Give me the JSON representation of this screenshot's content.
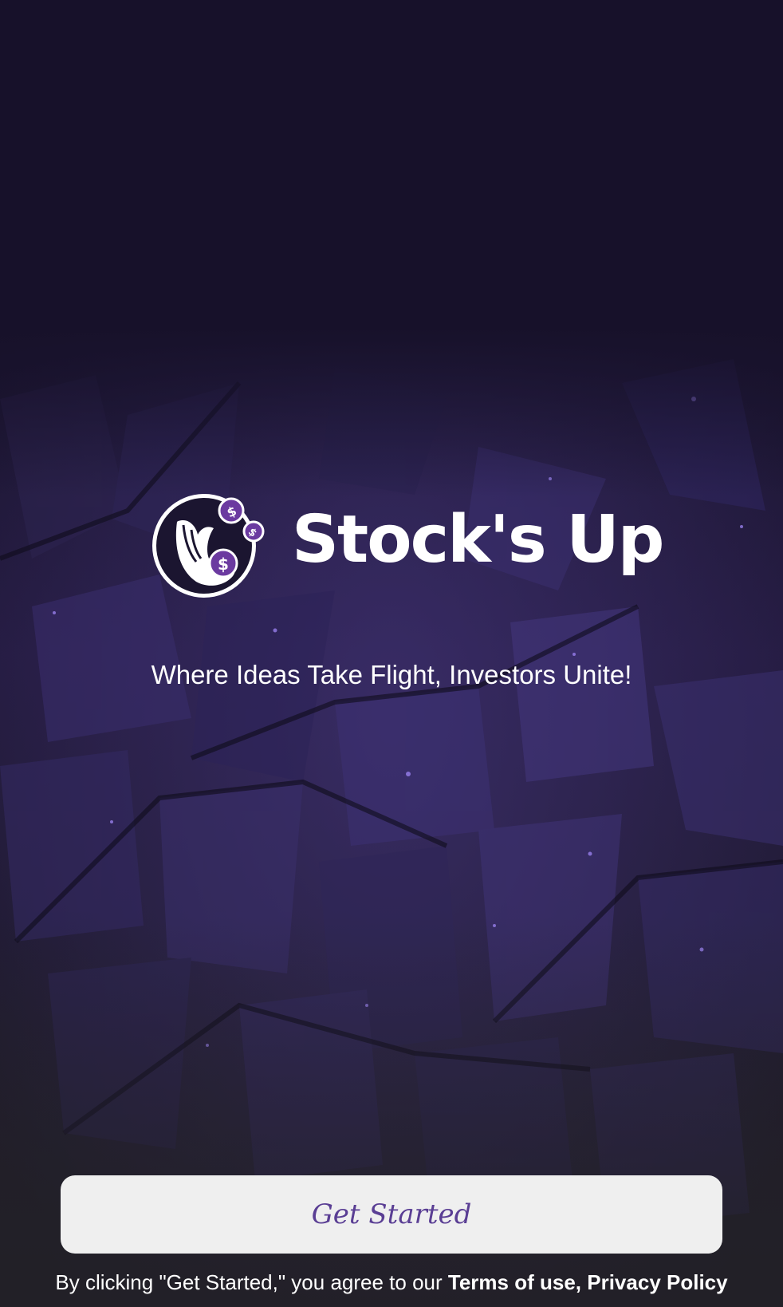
{
  "app": {
    "brand_name": "Stock's Up",
    "tagline": "Where Ideas Take Flight, Investors Unite!"
  },
  "logo": {
    "icon": "hand-with-dollar-coins-icon",
    "coin_symbol": "$"
  },
  "actions": {
    "get_started_label": "Get Started"
  },
  "legal": {
    "prefix": "By clicking \"Get Started,\" you agree to our ",
    "terms_label": "Terms of use,",
    "privacy_label": "Privacy Policy"
  },
  "colors": {
    "background_top": "#17112a",
    "background_mid": "#231a3e",
    "accent_purple": "#5a3e94",
    "button_bg": "#efefef",
    "text_white": "#ffffff"
  }
}
